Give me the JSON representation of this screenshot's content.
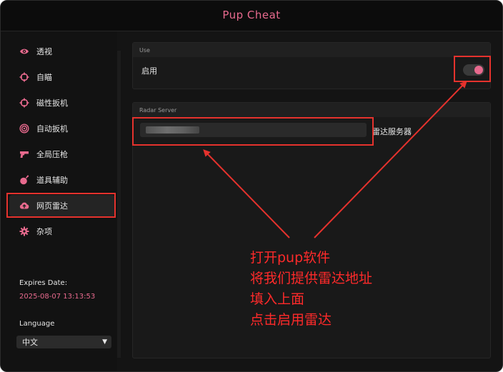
{
  "window": {
    "title": "Pup Cheat"
  },
  "sidebar": {
    "items": [
      {
        "label": "透视",
        "icon": "eye-icon"
      },
      {
        "label": "自瞄",
        "icon": "crosshair-icon"
      },
      {
        "label": "磁性扳机",
        "icon": "crosshair-icon"
      },
      {
        "label": "自动扳机",
        "icon": "target-icon"
      },
      {
        "label": "全局压枪",
        "icon": "gun-icon"
      },
      {
        "label": "道具辅助",
        "icon": "bomb-icon"
      },
      {
        "label": "网页雷达",
        "icon": "cloud-upload-icon",
        "active": true
      },
      {
        "label": "杂项",
        "icon": "gear-icon"
      }
    ],
    "expires_label": "Expires Date:",
    "expires_value": "2025-08-07 13:13:53",
    "language_label": "Language",
    "language_value": "中文"
  },
  "use_panel": {
    "header": "Use",
    "enable_label": "启用",
    "enabled": true
  },
  "radar_panel": {
    "header": "Radar Server",
    "server_label": "雷达服务器"
  },
  "annotation": {
    "lines": [
      "打开pup软件",
      "将我们提供雷达地址",
      "填入上面",
      "点击启用雷达"
    ]
  },
  "colors": {
    "accent": "#e86a8e",
    "annotation_red": "#e5322d",
    "background": "#141414"
  }
}
